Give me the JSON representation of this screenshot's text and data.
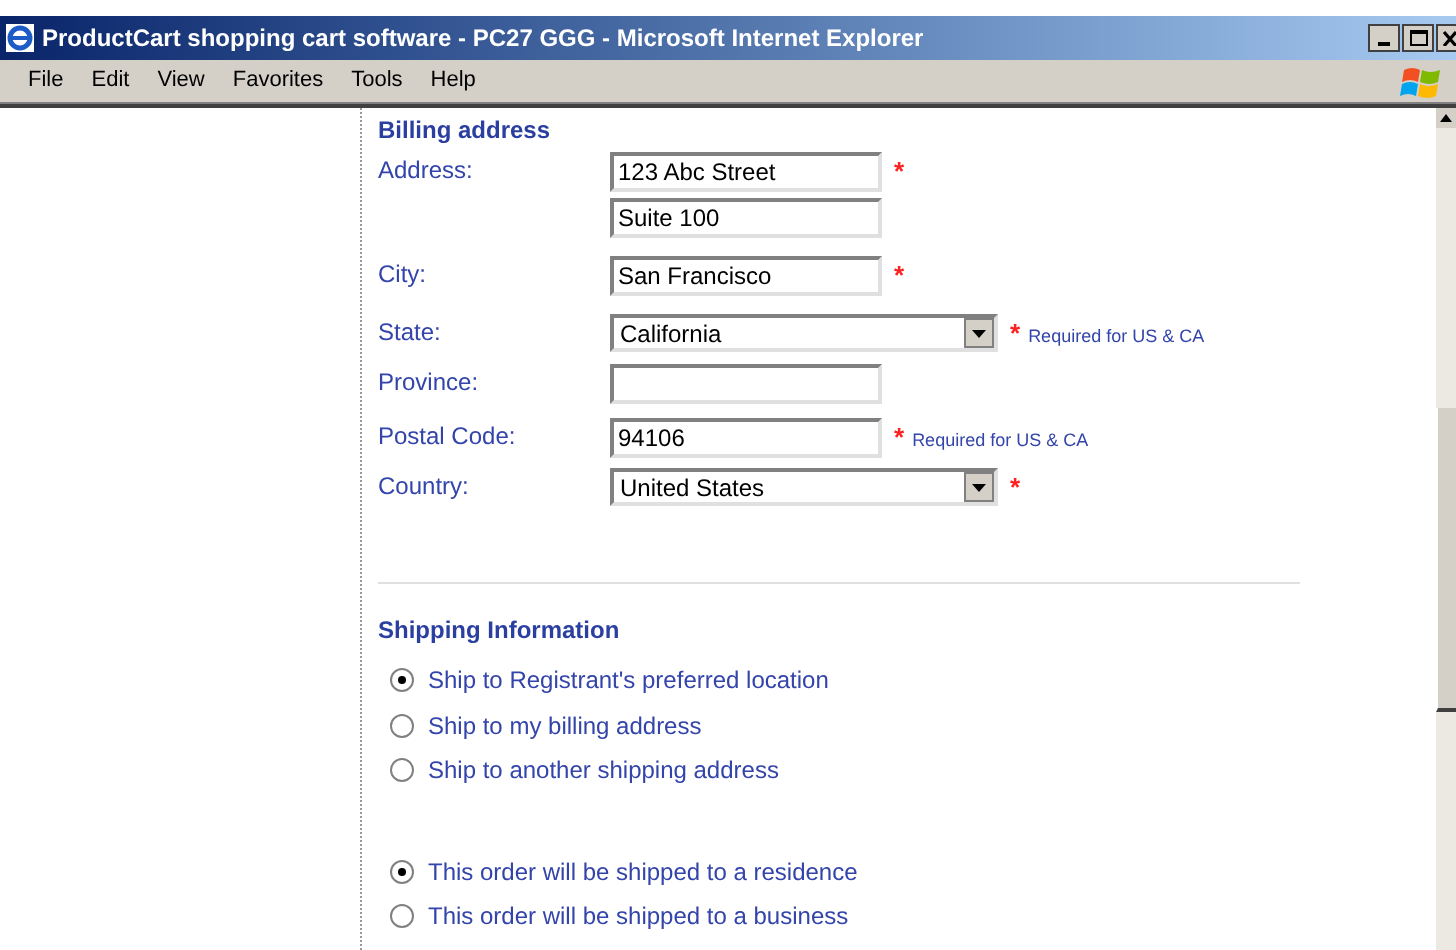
{
  "window": {
    "title": "ProductCart shopping cart software - PC27 GGG - Microsoft Internet Explorer"
  },
  "menu": [
    "File",
    "Edit",
    "View",
    "Favorites",
    "Tools",
    "Help"
  ],
  "billing": {
    "heading": "Billing address",
    "rows": [
      {
        "label": "Address:",
        "kind": "text",
        "value": "123 Abc Street",
        "marker": "*"
      },
      {
        "kind": "text",
        "value": "Suite 100"
      },
      {
        "label": "City:",
        "kind": "text",
        "value": "San Francisco",
        "marker": "*"
      },
      {
        "label": "State:",
        "kind": "select",
        "value": "California",
        "marker": "*",
        "note": "Required for US & CA"
      },
      {
        "label": "Province:",
        "kind": "text"
      },
      {
        "label": "Postal Code:",
        "kind": "text",
        "value": "94106",
        "marker": "*",
        "note": "Required for US & CA"
      },
      {
        "label": "Country:",
        "kind": "select",
        "value": "United States",
        "marker": "*"
      }
    ]
  },
  "shipping": {
    "heading": "Shipping Information",
    "groups": [
      [
        {
          "label": "Ship to Registrant's preferred location",
          "selected": true
        },
        {
          "label": "Ship to my billing address",
          "selected": false
        },
        {
          "label": "Ship to another shipping address",
          "selected": false
        }
      ],
      [
        {
          "label": "This order will be shipped to a residence",
          "selected": true
        },
        {
          "label": "This order will be shipped to a business",
          "selected": false
        }
      ]
    ]
  }
}
